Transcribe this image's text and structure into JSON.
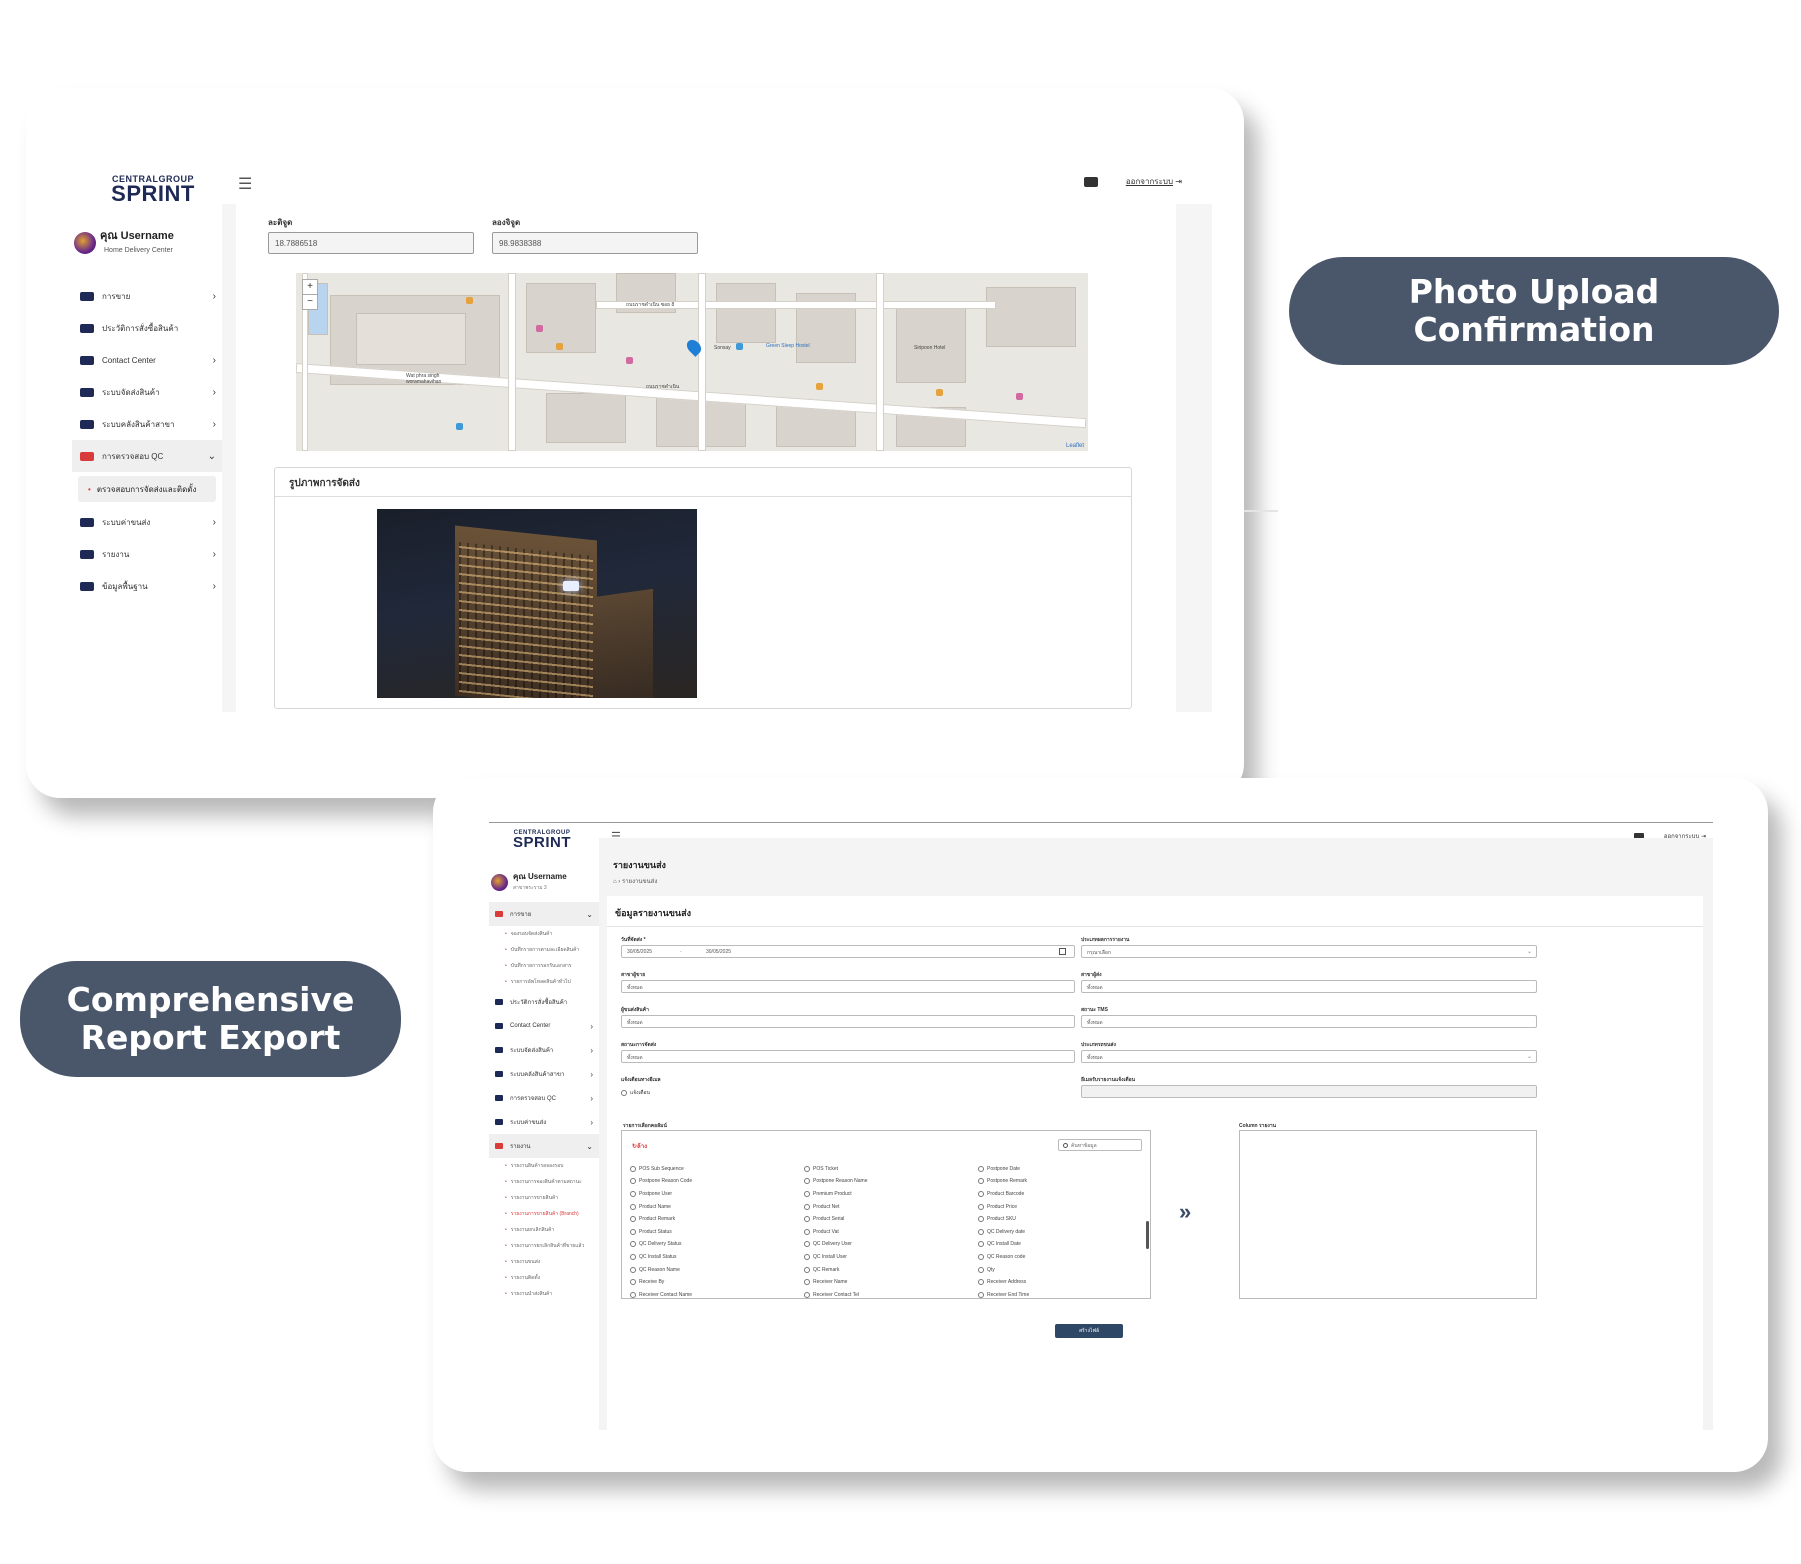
{
  "brand": {
    "top": "CENTRALGROUP",
    "main": "SPRINT"
  },
  "pills": {
    "photo_upload": "Photo Upload Confirmation",
    "report_export": "Comprehensive Report Export"
  },
  "card1": {
    "user": {
      "name": "คุณ Username",
      "role": "Home Delivery Center"
    },
    "logout": "ออกจากระบบ",
    "sidebar": [
      {
        "label": "การขาย",
        "icon": "cart-icon",
        "chevron": "›"
      },
      {
        "label": "ประวัติการสั่งซื้อสินค้า",
        "icon": "history-icon",
        "chevron": ""
      },
      {
        "label": "Contact Center",
        "icon": "headset-icon",
        "chevron": "›"
      },
      {
        "label": "ระบบจัดส่งสินค้า",
        "icon": "truck-icon",
        "chevron": "›"
      },
      {
        "label": "ระบบคลังสินค้าสาขา",
        "icon": "warehouse-icon",
        "chevron": "›"
      },
      {
        "label": "การตรวจสอบ QC",
        "icon": "clipboard-icon",
        "chevron": "⌄"
      }
    ],
    "sidebar_sub": "ตรวจสอบการจัดส่งและติดตั้ง",
    "sidebar_after": [
      {
        "label": "ระบบค่าขนส่ง",
        "icon": "money-icon",
        "chevron": "›"
      },
      {
        "label": "รายงาน",
        "icon": "report-icon",
        "chevron": "›"
      },
      {
        "label": "ข้อมูลพื้นฐาน",
        "icon": "database-icon",
        "chevron": "›"
      }
    ],
    "latitude_label": "ละติจูด",
    "latitude_value": "18.7886518",
    "longitude_label": "ลองจิจูด",
    "longitude_value": "98.9838388",
    "map": {
      "zoom_in": "+",
      "zoom_out": "−",
      "attribution": "Leaflet",
      "labels": [
        "ถนนราชดำเนิน ซอย 8",
        "ถนนราชดำเนิน",
        "Wat phra singh woramahavihan",
        "Sonsay",
        "Green Sleep Hostel",
        "Siripoon Hotel"
      ]
    },
    "photo_section_title": "รูปภาพการจัดส่ง"
  },
  "card2": {
    "user": {
      "name": "คุณ Username",
      "role": "สาขาพระราม 3"
    },
    "logout": "ออกจากระบบ",
    "page_title": "รายงานขนส่ง",
    "breadcrumb": "รายงานขนส่ง",
    "panel_title": "ข้อมูลรายงานขนส่ง",
    "sidebar": [
      {
        "label": "การขาย",
        "open": true,
        "chevron": "⌄"
      }
    ],
    "sidebar_sales_subs": [
      "จองรอบจัดส่งสินค้า",
      "บันทึกรายการตามละเอียดสินค้า",
      "บันทึกรายการรอกรับเอกสาร",
      "รายการอัพโหลดสินค้าทั่วไป"
    ],
    "sidebar_mid": [
      {
        "label": "ประวัติการสั่งซื้อสินค้า",
        "chevron": ""
      },
      {
        "label": "Contact Center",
        "chevron": "›"
      },
      {
        "label": "ระบบจัดส่งสินค้า",
        "chevron": "›"
      },
      {
        "label": "ระบบคลังสินค้าสาขา",
        "chevron": "›"
      },
      {
        "label": "การตรวจสอบ QC",
        "chevron": "›"
      },
      {
        "label": "ระบบค่าขนส่ง",
        "chevron": "›"
      },
      {
        "label": "รายงาน",
        "chevron": "⌄"
      }
    ],
    "sidebar_report_subs": [
      "รายงานสินค้ารอจองรอบ",
      "รายงานการจองสินค้าตามสถานะ",
      "รายงานการขายสินค้า",
      "รายงานการขายสินค้า (Branch)",
      "รายงานยกเลิกสินค้า",
      "รายงานการยกเลิกสินค้าที่ขายแล้ว",
      "รายงานขนส่ง",
      "รายงานติดตั้ง",
      "รายงานนำส่งสินค้า"
    ],
    "form": {
      "date_label": "วันที่จัดส่ง *",
      "date_from": "30/05/2025",
      "date_to": "30/05/2025",
      "report_type_label": "ประเภทผลการรายงาน",
      "report_type_value": "กรุณาเลือก",
      "sales_branch_label": "สาขาผู้ขาย",
      "sales_branch_value": "ทั้งหมด",
      "ship_branch_label": "สาขาผู้ส่ง",
      "ship_branch_value": "ทั้งหมด",
      "delivery_label": "ผู้ขนส่งสินค้า",
      "delivery_value": "ทั้งหมด",
      "tms_status_label": "สถานะ TMS",
      "tms_status_value": "ทั้งหมด",
      "ship_status_label": "สถานะการจัดส่ง",
      "ship_status_value": "ทั้งหมด",
      "car_type_label": "ประเภทรถขนส่ง",
      "car_type_value": "ทั้งหมด",
      "email_notify_label": "แจ้งเตือนทางอีเมล",
      "email_notify_option": "แจ้งเตือน",
      "email_label": "อีเมลรับรายงานแจ้งเตือน",
      "columns_label": "รายการเลือกคอลัมน์",
      "reset_label": "ล้าง",
      "search_placeholder": "ค้นหาข้อมูล",
      "selected_label": "Column รายงาน",
      "submit_label": "สร้างไฟล์"
    },
    "columns": [
      "POS Sub Sequence",
      "POS Ticket",
      "Postpone Date",
      "Postpone Reason Code",
      "Postpone Reason Name",
      "Postpone Remark",
      "Postpone User",
      "Premium Product",
      "Product Barcode",
      "Product Name",
      "Product Net",
      "Product Price",
      "Product Remark",
      "Product Serial",
      "Product SKU",
      "Product Status",
      "Product Vat",
      "QC Delivery date",
      "QC Delivery Status",
      "QC Delivery User",
      "QC Install Date",
      "QC Install Status",
      "QC Install User",
      "QC Reason code",
      "QC Reason Name",
      "QC Remark",
      "Qty",
      "Receive By",
      "Receiver Name",
      "Receiver Address",
      "Receiver Contact Name",
      "Receiver Contact Tel",
      "Receiver End Time"
    ]
  },
  "colors": {
    "pill": "#4a576b",
    "brand": "#1e2a55",
    "accent_red": "#d93a3a",
    "button": "#2e4766"
  }
}
